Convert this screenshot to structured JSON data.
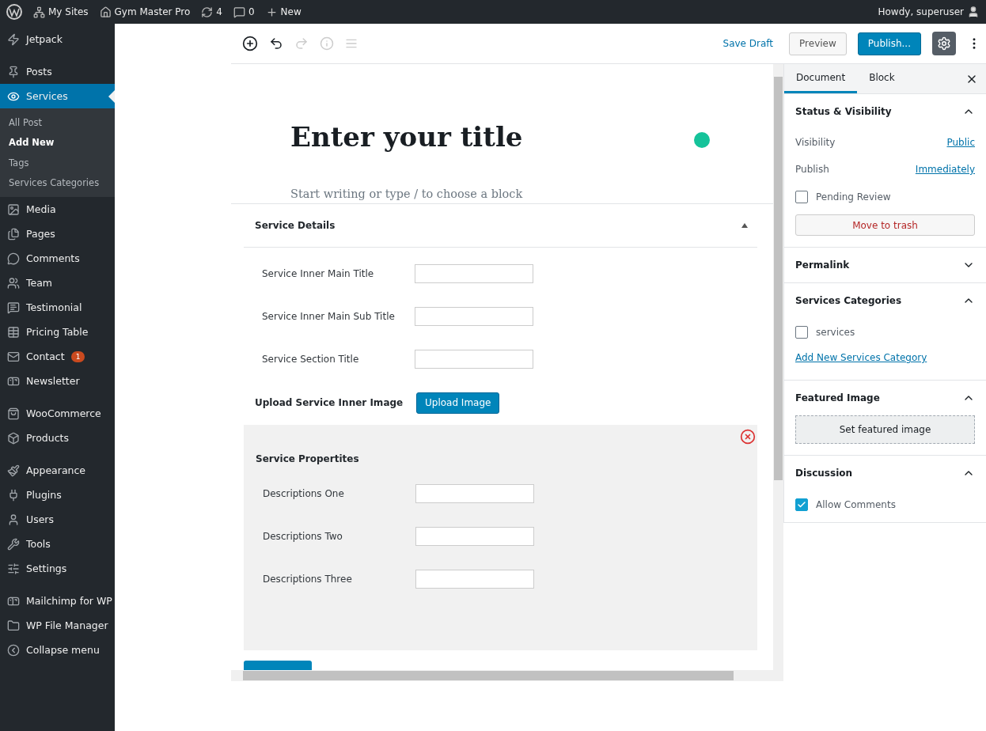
{
  "admin_bar": {
    "items": [
      {
        "label": "My Sites"
      },
      {
        "label": "Gym Master Pro"
      },
      {
        "label": "4"
      },
      {
        "label": "0"
      },
      {
        "label": "New"
      }
    ],
    "greeting": "Howdy, superuser"
  },
  "sidebar": {
    "groups": [
      [
        {
          "label": "Jetpack",
          "selected": false
        }
      ],
      [
        {
          "label": "Posts",
          "selected": false
        },
        {
          "label": "Services",
          "selected": true,
          "children": [
            {
              "label": "All Post",
              "selected": false
            },
            {
              "label": "Add New",
              "selected": true
            },
            {
              "label": "Tags",
              "selected": false
            },
            {
              "label": "Services Categories",
              "selected": false
            }
          ]
        },
        {
          "label": "Media",
          "selected": false
        },
        {
          "label": "Pages",
          "selected": false
        },
        {
          "label": "Comments",
          "selected": false
        },
        {
          "label": "Team",
          "selected": false
        },
        {
          "label": "Testimonial",
          "selected": false
        },
        {
          "label": "Pricing Table",
          "selected": false
        },
        {
          "label": "Contact",
          "selected": false,
          "badge": "1"
        },
        {
          "label": "Newsletter",
          "selected": false
        }
      ],
      [
        {
          "label": "WooCommerce",
          "selected": false
        },
        {
          "label": "Products",
          "selected": false
        }
      ],
      [
        {
          "label": "Appearance",
          "selected": false
        },
        {
          "label": "Plugins",
          "selected": false
        },
        {
          "label": "Users",
          "selected": false
        },
        {
          "label": "Tools",
          "selected": false
        },
        {
          "label": "Settings",
          "selected": false
        }
      ],
      [
        {
          "label": "Mailchimp for WP",
          "selected": false
        },
        {
          "label": "WP File Manager",
          "selected": false
        },
        {
          "label": "Collapse menu",
          "selected": false
        }
      ]
    ]
  },
  "toolbar": {
    "save_draft": "Save Draft",
    "preview": "Preview",
    "publish": "Publish..."
  },
  "editor": {
    "title_placeholder": "Enter your title",
    "body_placeholder": "Start writing or type / to choose a block"
  },
  "meta_box": {
    "title": "Service Details",
    "expanded": true,
    "fields": [
      {
        "label": "Service Inner Main Title"
      },
      {
        "label": "Service Inner Main Sub Title"
      },
      {
        "label": "Service Section Title"
      }
    ],
    "upload_label": "Upload Service Inner Image",
    "upload_button": "Upload Image",
    "properties": {
      "title": "Service Propertites",
      "fields": [
        {
          "label": "Descriptions One"
        },
        {
          "label": "Descriptions Two"
        },
        {
          "label": "Descriptions Three"
        }
      ]
    }
  },
  "settings": {
    "tabs": [
      {
        "label": "Document",
        "selected": true
      },
      {
        "label": "Block",
        "selected": false
      }
    ],
    "panels": [
      {
        "title": "Status & Visibility",
        "expanded": true,
        "kind": "status",
        "rows": [
          {
            "label": "Visibility",
            "value": "Public"
          },
          {
            "label": "Publish",
            "value": "Immediately"
          }
        ],
        "pending": {
          "label": "Pending Review",
          "checked": false
        },
        "trash": "Move to trash"
      },
      {
        "title": "Permalink",
        "expanded": false
      },
      {
        "title": "Services Categories",
        "expanded": true,
        "kind": "categories",
        "options": [
          {
            "label": "services",
            "checked": false
          }
        ],
        "add_link": "Add New Services Category"
      },
      {
        "title": "Featured Image",
        "expanded": true,
        "kind": "image",
        "button": "Set featured image"
      },
      {
        "title": "Discussion",
        "expanded": true,
        "kind": "discussion",
        "options": [
          {
            "label": "Allow Comments",
            "checked": true
          }
        ]
      }
    ]
  }
}
